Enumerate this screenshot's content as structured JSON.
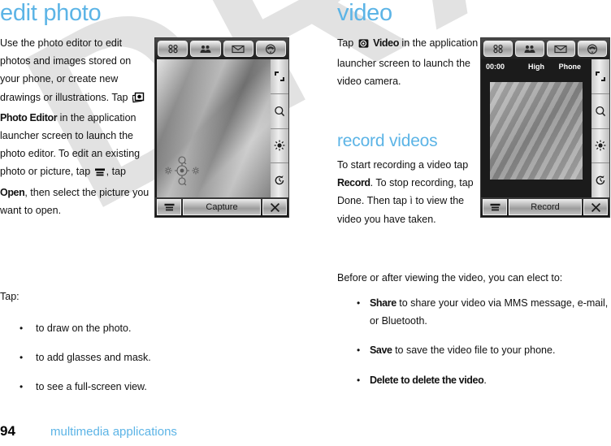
{
  "footer": {
    "page_number": "94",
    "section_label": "multimedia applications"
  },
  "colors": {
    "heading_blue": "#5cb4e6",
    "body_black": "#111111",
    "watermark_gray": "#e2e2e2"
  },
  "watermark": {
    "text": "DRAFT"
  },
  "left_column": {
    "title": "edit photo",
    "paragraph1_a": "Use the photo editor to edit photos and images stored on your phone, or create new drawings or illustrations. Tap ",
    "photo_editor_label": "Photo Editor",
    "paragraph1_b": " in the application launcher screen to launch the photo editor. To edit an existing photo or picture, tap ",
    "paragraph1_c": ", tap ",
    "open_label": "Open",
    "paragraph1_d": ", then select the picture you want to open.",
    "tap_label": "Tap:",
    "bullets": [
      "to draw on the photo.",
      "to add glasses and mask.",
      "to see a full-screen view."
    ],
    "icons": {
      "photo_editor": "photo-editor-icon",
      "menu": "menu-icon"
    }
  },
  "right_column": {
    "title": "video",
    "paragraph1_a": "Tap ",
    "video_label": "Video",
    "paragraph1_b": " in the application launcher screen to launch the video camera.",
    "subtitle": "record videos",
    "paragraph2_a": "To start recording a video tap ",
    "record_label": "Record",
    "paragraph2_b": ". To stop recording, tap Done. Then tap ì to view the video you have taken.",
    "paragraph3": "Before or after viewing the video, you can elect to:",
    "bullets": [
      {
        "term": "Share",
        "rest": " to share your video via MMS message, e-mail, or Bluetooth."
      },
      {
        "term": "Save",
        "rest": " to save the video file to your phone."
      },
      {
        "term": "Delete to delete the video",
        "rest": "."
      }
    ],
    "icons": {
      "video": "video-camera-icon"
    }
  },
  "device_photo": {
    "name": "photo-editor-capture-screen",
    "topbar_buttons": [
      "apps-grid-icon",
      "contacts-icon",
      "message-envelope-icon",
      "dialer-icon"
    ],
    "sidebar_buttons": [
      "resize-icon",
      "zoom-search-icon",
      "brightness-icon",
      "timer-icon"
    ],
    "softkey_left": "menu-icon",
    "softkey_center_label": "Capture",
    "softkey_right": "close-x-icon"
  },
  "device_video": {
    "name": "video-camera-record-screen",
    "topbar_buttons": [
      "apps-grid-icon",
      "contacts-icon",
      "message-envelope-icon",
      "dialer-icon"
    ],
    "status": {
      "timer": "00:00",
      "quality": "High",
      "storage": "Phone"
    },
    "sidebar_buttons": [
      "resize-icon",
      "zoom-search-icon",
      "brightness-icon",
      "timer-icon"
    ],
    "softkey_left": "menu-icon",
    "softkey_center_label": "Record",
    "softkey_right": "close-x-icon"
  }
}
